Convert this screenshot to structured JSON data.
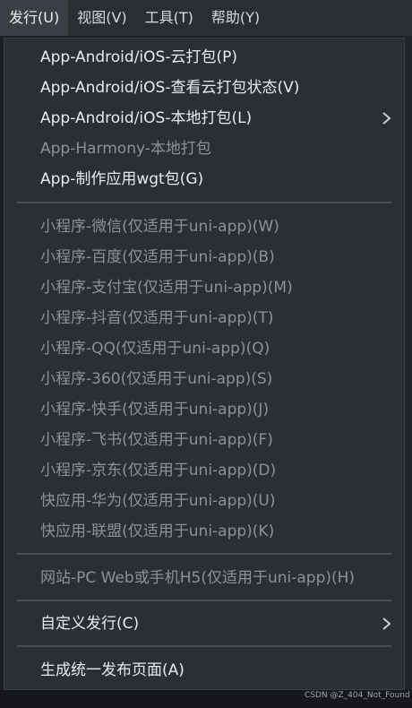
{
  "menubar": {
    "items": [
      {
        "label": "发行(U)",
        "active": true
      },
      {
        "label": "视图(V)",
        "active": false
      },
      {
        "label": "工具(T)",
        "active": false
      },
      {
        "label": "帮助(Y)",
        "active": false
      }
    ]
  },
  "dropdown": {
    "app_section": [
      {
        "label": "App-Android/iOS-云打包(P)",
        "enabled": true
      },
      {
        "label": "App-Android/iOS-查看云打包状态(V)",
        "enabled": true
      },
      {
        "label": "App-Android/iOS-本地打包(L)",
        "enabled": true,
        "submenu": true
      },
      {
        "label": "App-Harmony-本地打包",
        "enabled": false
      },
      {
        "label": "App-制作应用wgt包(G)",
        "enabled": true
      }
    ],
    "miniprogram_section": [
      {
        "label": "小程序-微信(仅适用于uni-app)(W)",
        "enabled": false
      },
      {
        "label": "小程序-百度(仅适用于uni-app)(B)",
        "enabled": false
      },
      {
        "label": "小程序-支付宝(仅适用于uni-app)(M)",
        "enabled": false
      },
      {
        "label": "小程序-抖音(仅适用于uni-app)(T)",
        "enabled": false
      },
      {
        "label": "小程序-QQ(仅适用于uni-app)(Q)",
        "enabled": false
      },
      {
        "label": "小程序-360(仅适用于uni-app)(S)",
        "enabled": false
      },
      {
        "label": "小程序-快手(仅适用于uni-app)(J)",
        "enabled": false
      },
      {
        "label": "小程序-飞书(仅适用于uni-app)(F)",
        "enabled": false
      },
      {
        "label": "小程序-京东(仅适用于uni-app)(D)",
        "enabled": false
      },
      {
        "label": "快应用-华为(仅适用于uni-app)(U)",
        "enabled": false
      },
      {
        "label": "快应用-联盟(仅适用于uni-app)(K)",
        "enabled": false
      }
    ],
    "web_section": [
      {
        "label": "网站-PC Web或手机H5(仅适用于uni-app)(H)",
        "enabled": false
      }
    ],
    "custom_section": [
      {
        "label": "自定义发行(C)",
        "enabled": true,
        "submenu": true
      }
    ],
    "publish_section": [
      {
        "label": "生成统一发布页面(A)",
        "enabled": true
      }
    ]
  },
  "watermark": "CSDN @Z_404_Not_Found",
  "colors": {
    "menubar_bg": "#2a2d31",
    "dropdown_bg": "#2b2f34",
    "enabled_text": "#e8eaed",
    "disabled_text": "#8b9197",
    "separator": "#4a4f55"
  }
}
